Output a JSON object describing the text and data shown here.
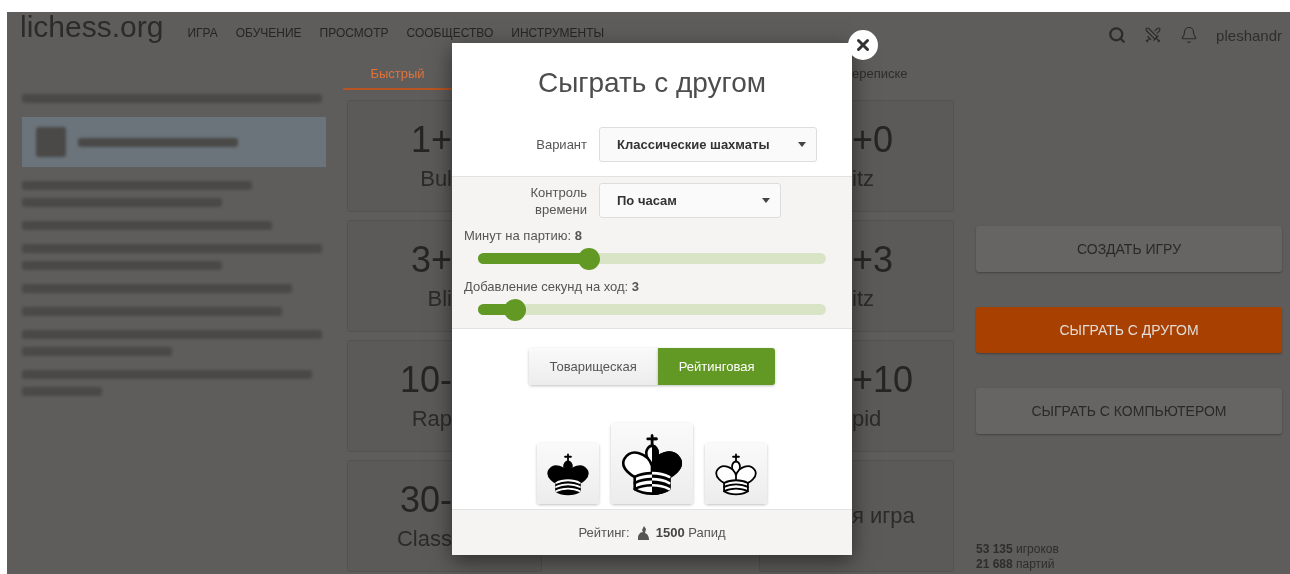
{
  "header": {
    "logo": "lichess.org",
    "nav": [
      "ИГРА",
      "ОБУЧЕНИЕ",
      "ПРОСМОТР",
      "СООБЩЕСТВО",
      "ИНСТРУМЕНТЫ"
    ],
    "user": "pleshandr"
  },
  "tabs": [
    {
      "label": "Быстрый",
      "selected": true
    },
    {
      "label": "ереписке",
      "selected": false
    }
  ],
  "pools": [
    {
      "kind": "left",
      "time": "1+",
      "name": "Bul"
    },
    {
      "kind": "right",
      "time": "+0",
      "name": "itz"
    },
    {
      "kind": "left",
      "time": "3+",
      "name": "Bli"
    },
    {
      "kind": "right",
      "time": "+3",
      "name": "itz"
    },
    {
      "kind": "left",
      "time": "10-",
      "name": "Rap"
    },
    {
      "kind": "right",
      "time": "+10",
      "name": "pid"
    },
    {
      "kind": "left",
      "time": "30-",
      "name": "Class"
    },
    {
      "kind": "right",
      "name": "я игра"
    }
  ],
  "actions": [
    {
      "label": "СОЗДАТЬ ИГРУ",
      "highlighted": false
    },
    {
      "label": "СЫГРАТЬ С ДРУГОМ",
      "highlighted": true
    },
    {
      "label": "СЫГРАТЬ С КОМПЬЮТЕРОМ",
      "highlighted": false
    }
  ],
  "stats": [
    "**53 135** игроков",
    "**21 688** партий"
  ],
  "modal": {
    "title": "Сыграть с другом",
    "variant": {
      "label": "Вариант",
      "value": "Классические шахматы"
    },
    "time_control": {
      "label": "Контроль времени",
      "value": "По часам"
    },
    "sliders": [
      {
        "label": "Минут на партию: **8**",
        "level": 0.32
      },
      {
        "label": "Добавление секунд на ход: **3**",
        "level": 0.106
      }
    ],
    "modes": [
      {
        "label": "Товарищеская",
        "selected": false
      },
      {
        "label": "Рейтинговая",
        "selected": true
      }
    ],
    "colors": [
      {
        "kind": "black"
      },
      {
        "kind": "random"
      },
      {
        "kind": "white"
      }
    ],
    "rating": {
      "label": "Рейтинг:",
      "value": "1500",
      "category": "Рапид"
    }
  }
}
